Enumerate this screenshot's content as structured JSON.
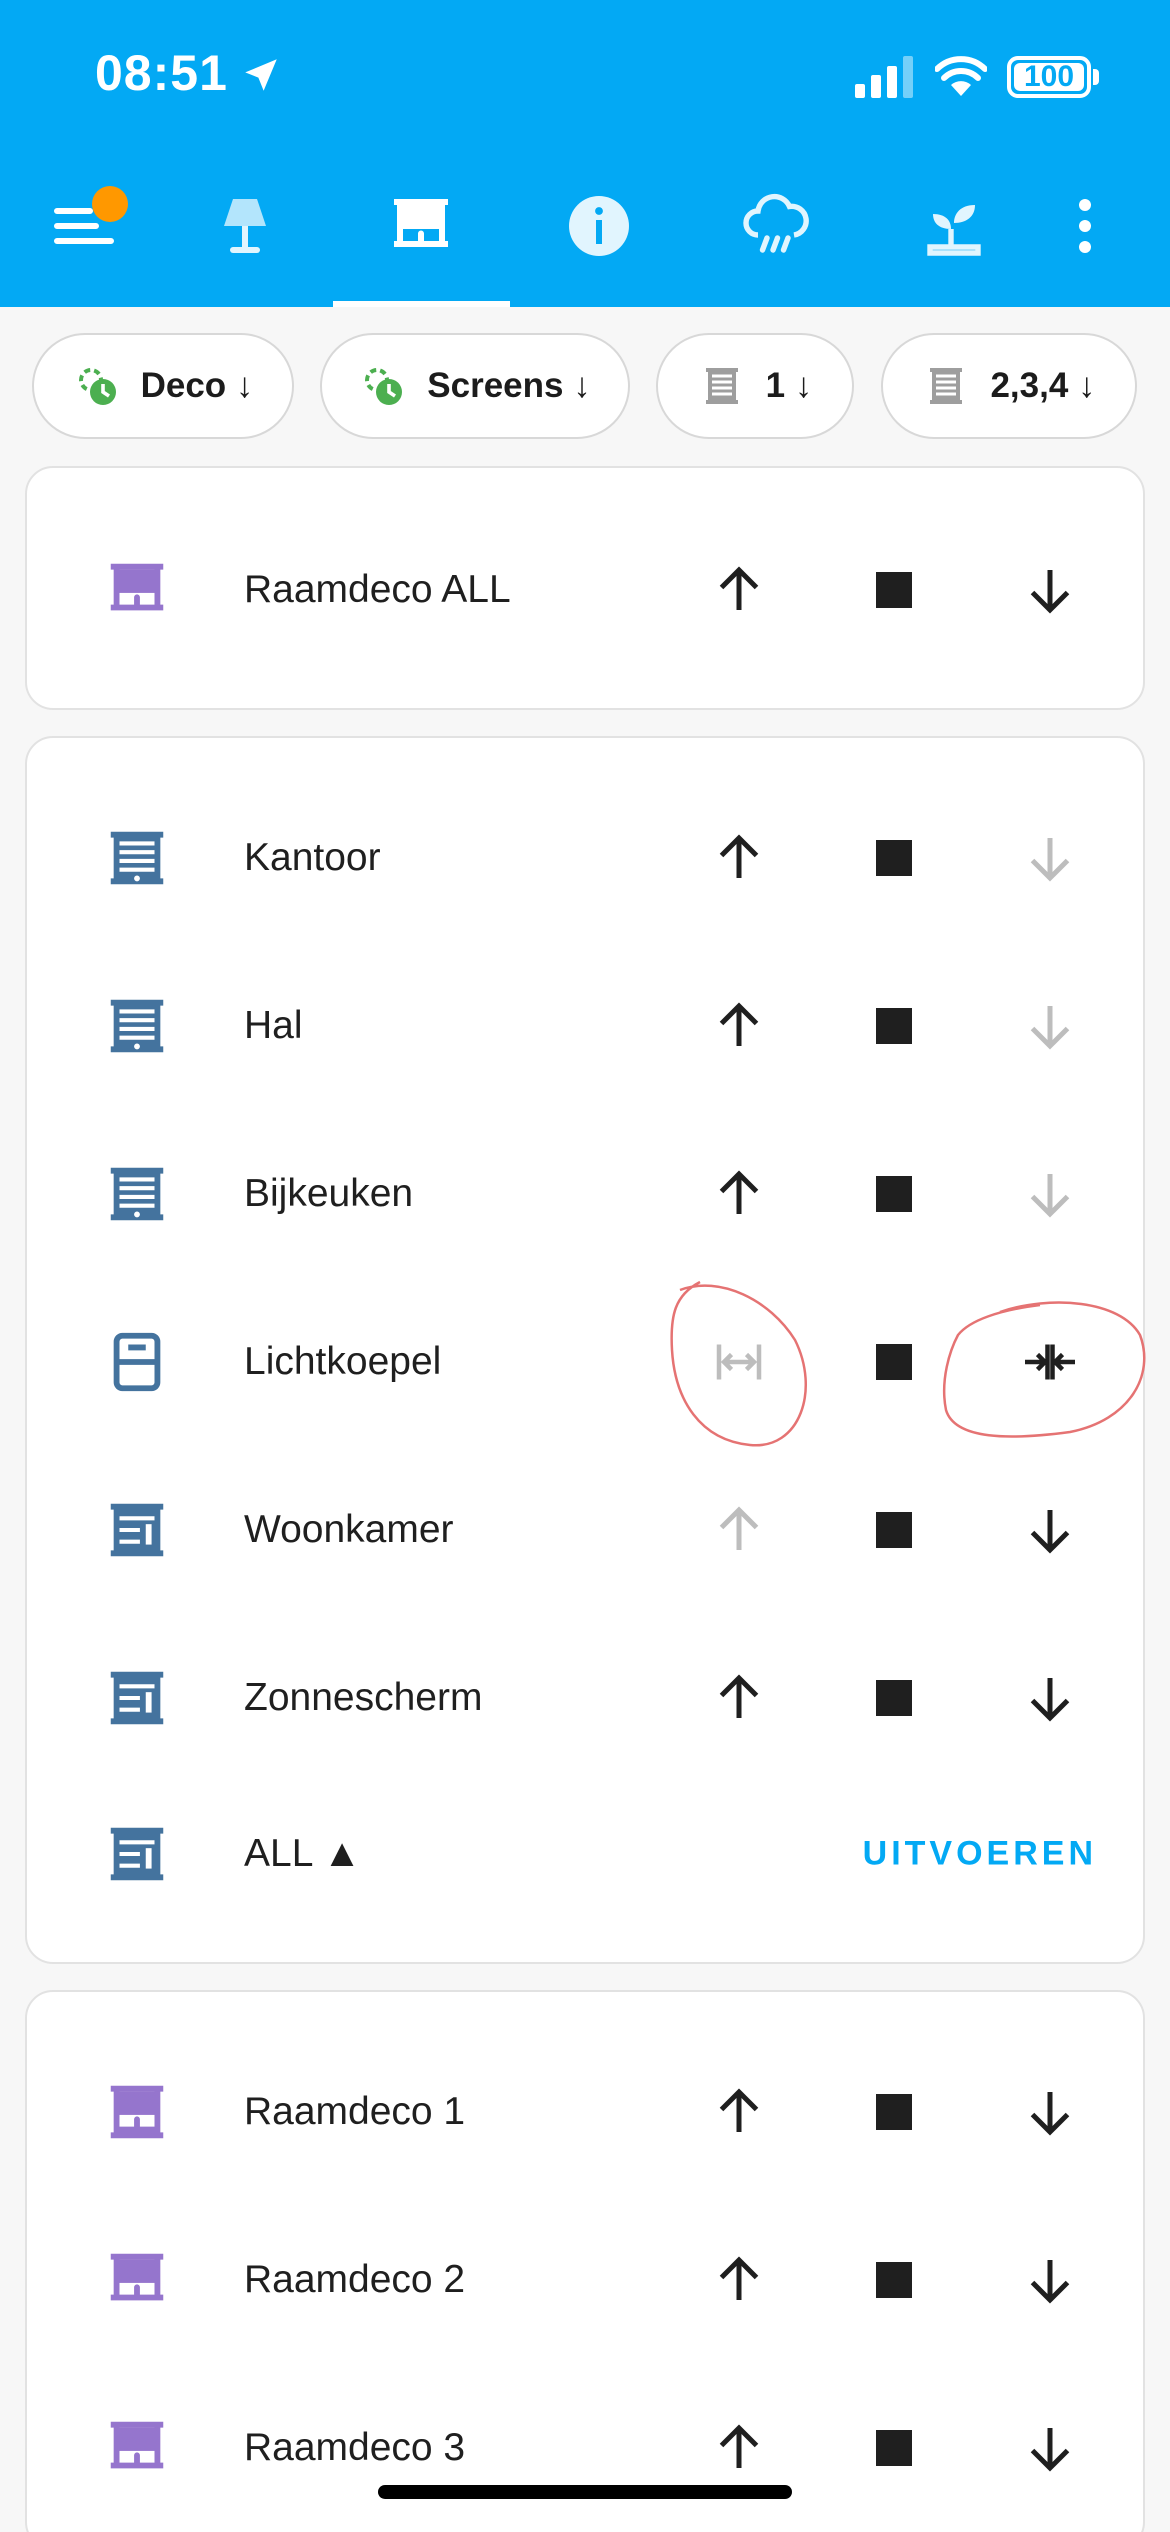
{
  "status_bar": {
    "time": "08:51",
    "battery": "100"
  },
  "tabs": [
    {
      "icon": "menu-icon",
      "name": "menu"
    },
    {
      "icon": "lamp-icon",
      "name": "lights"
    },
    {
      "icon": "window-shade-icon",
      "name": "covers"
    },
    {
      "icon": "info-icon",
      "name": "info"
    },
    {
      "icon": "rain-cloud-icon",
      "name": "weather"
    },
    {
      "icon": "plant-icon",
      "name": "garden"
    }
  ],
  "colors": {
    "primary": "#03a9f4",
    "purple": "#9575cd",
    "blue_icon": "#44739e",
    "green": "#4caf50",
    "disabled": "#bdbdbd"
  },
  "chips": [
    {
      "label": "Deco ↓",
      "icon": "auto-schedule-icon"
    },
    {
      "label": "Screens ↓",
      "icon": "auto-schedule-icon"
    },
    {
      "label": "1 ↓",
      "icon": "blind-icon"
    },
    {
      "label": "2,3,4 ↓",
      "icon": "blind-icon"
    }
  ],
  "cards": {
    "all_deco": {
      "rows": [
        {
          "name": "Raamdeco ALL"
        }
      ]
    },
    "screens": {
      "rows": [
        {
          "name": "Kantoor"
        },
        {
          "name": "Hal"
        },
        {
          "name": "Bijkeuken"
        },
        {
          "name": "Lichtkoepel"
        },
        {
          "name": "Woonkamer"
        },
        {
          "name": "Zonnescherm"
        },
        {
          "name": "ALL ▲",
          "action": "UITVOEREN"
        }
      ]
    },
    "deco": {
      "rows": [
        {
          "name": "Raamdeco 1"
        },
        {
          "name": "Raamdeco 2"
        },
        {
          "name": "Raamdeco 3"
        }
      ]
    }
  }
}
